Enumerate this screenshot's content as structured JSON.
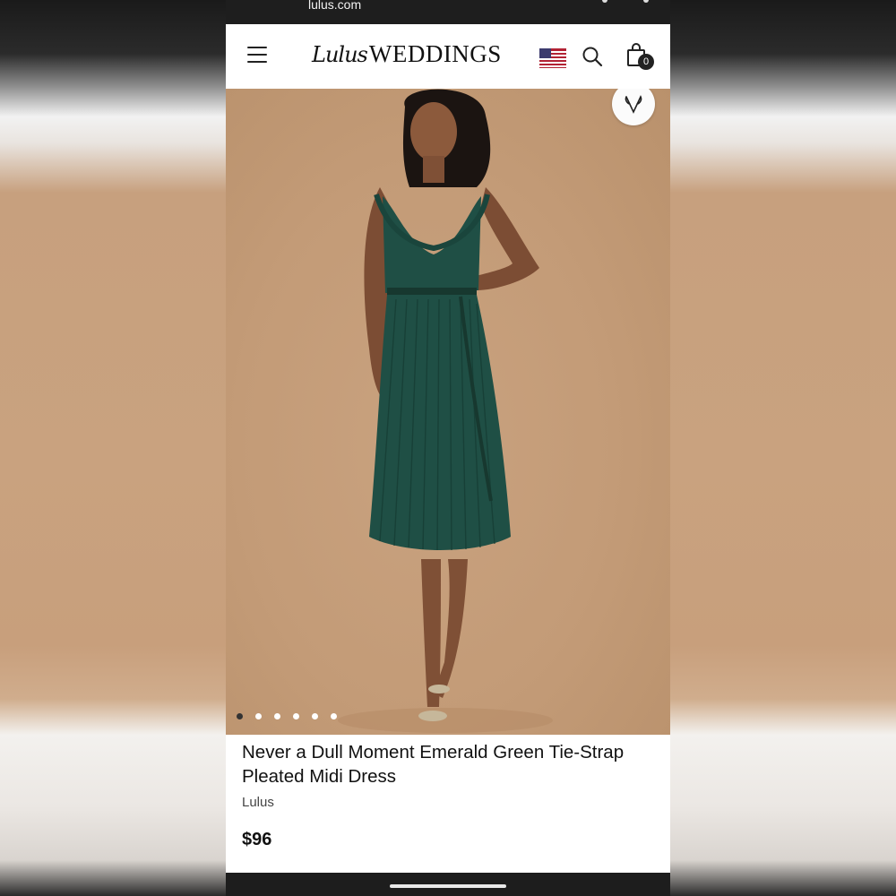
{
  "status_bar": {
    "url": "lulus.com"
  },
  "header": {
    "logo_script": "Lulus",
    "logo_weddings": "WEDDINGS",
    "cart_count": "0",
    "icons": [
      "menu-icon",
      "us-flag-icon",
      "search-icon",
      "shopping-bag-icon"
    ]
  },
  "gallery": {
    "wishlist_icon": "heart-v-icon",
    "slide_count": 6,
    "active_slide": 1
  },
  "product": {
    "title": "Never a Dull Moment Emerald Green Tie-Strap Pleated Midi Dress",
    "brand": "Lulus",
    "price": "$96"
  },
  "colors": {
    "dress": "#1f4f45",
    "backdrop": "#c9a27f",
    "header_bg": "#ffffff"
  }
}
